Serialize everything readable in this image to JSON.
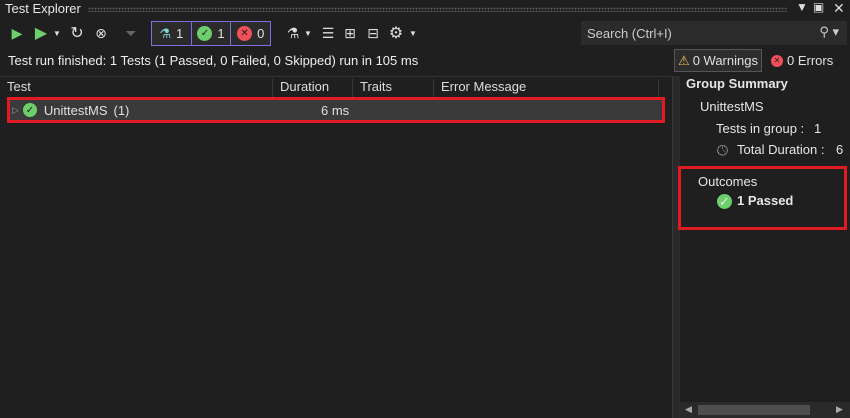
{
  "window": {
    "title": "Test Explorer"
  },
  "toolbar": {
    "total_count": "1",
    "passed_count": "1",
    "failed_count": "0"
  },
  "search": {
    "placeholder": "Search (Ctrl+I)"
  },
  "status": {
    "text": "Test run finished: 1 Tests (1 Passed, 0 Failed, 0 Skipped) run in 105 ms",
    "warnings": "0 Warnings",
    "errors": "0 Errors"
  },
  "table": {
    "columns": [
      "Test",
      "Duration",
      "Traits",
      "Error Message"
    ],
    "rows": [
      {
        "name": "UnittestMS",
        "count": "(1)",
        "duration": "6 ms"
      }
    ]
  },
  "summary": {
    "title": "Group Summary",
    "group": "UnittestMS",
    "tests_in_group_label": "Tests in group :",
    "tests_in_group": "1",
    "total_duration_label": "Total Duration :",
    "total_duration": "6",
    "outcomes_label": "Outcomes",
    "passed": "1 Passed"
  },
  "colors": {
    "highlight": "#e01b24",
    "passed": "#6ccf6c",
    "failed": "#f0505a",
    "accent": "#7a6fe0"
  }
}
